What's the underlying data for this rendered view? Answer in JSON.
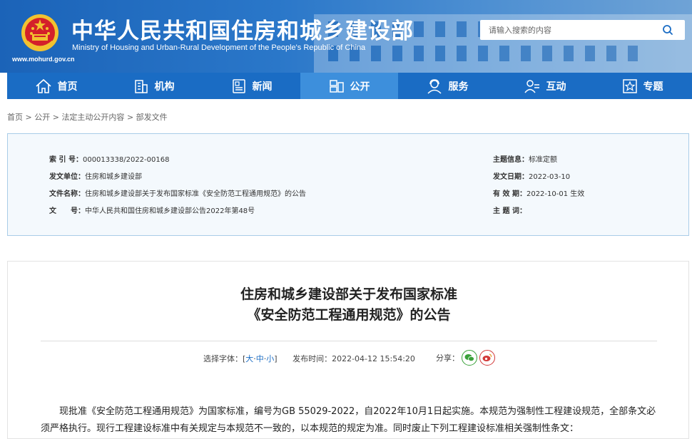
{
  "header": {
    "site_title": "中华人民共和国住房和城乡建设部",
    "site_subtitle": "Ministry of Housing and Urban-Rural Development of the People's Republic of China",
    "site_url": "www.mohurd.gov.cn",
    "search_placeholder": "请输入搜索的内容"
  },
  "nav": [
    {
      "label": "首页",
      "icon": "home-icon"
    },
    {
      "label": "机构",
      "icon": "building-icon"
    },
    {
      "label": "新闻",
      "icon": "news-icon"
    },
    {
      "label": "公开",
      "icon": "disclosure-icon"
    },
    {
      "label": "服务",
      "icon": "service-icon"
    },
    {
      "label": "互动",
      "icon": "interact-icon"
    },
    {
      "label": "专题",
      "icon": "star-icon"
    }
  ],
  "breadcrumb": [
    "首页",
    "公开",
    "法定主动公开内容",
    "部发文件"
  ],
  "breadcrumb_sep": ">",
  "meta": {
    "index_label": "索 引 号：",
    "index_value": "000013338/2022-00168",
    "issuer_label": "发文单位：",
    "issuer_value": "住房和城乡建设部",
    "filename_label": "文件名称：",
    "filename_value": "住房和城乡建设部关于发布国家标准《安全防范工程通用规范》的公告",
    "docno_label": "文　　号：",
    "docno_value": "中华人民共和国住房和城乡建设部公告2022年第48号",
    "topic_label": "主题信息：",
    "topic_value": "标准定额",
    "date_label": "发文日期：",
    "date_value": "2022-03-10",
    "validity_label": "有 效 期：",
    "validity_value": "2022-10-01 生效",
    "subject_label": "主 题 词：",
    "subject_value": ""
  },
  "article": {
    "title_line1": "住房和城乡建设部关于发布国家标准",
    "title_line2": "《安全防范工程通用规范》的公告",
    "font_label": "选择字体：[",
    "font_large": "大",
    "font_medium": "中",
    "font_small": "小",
    "font_sep": "·",
    "font_close": "]",
    "publish_label": "发布时间：",
    "publish_time": "2022-04-12 15:54:20",
    "share_label": "分享：",
    "body": "现批准《安全防范工程通用规范》为国家标准，编号为GB 55029-2022，自2022年10月1日起实施。本规范为强制性工程建设规范，全部条文必须严格执行。现行工程建设标准中有关规定与本规范不一致的，以本规范的规定为准。同时废止下列工程建设标准相关强制性条文："
  },
  "colors": {
    "nav_bg": "#1a6cc4",
    "nav_active": "#3d8fdc",
    "meta_bg": "#f4f9fd",
    "meta_border": "#a9cde8"
  }
}
